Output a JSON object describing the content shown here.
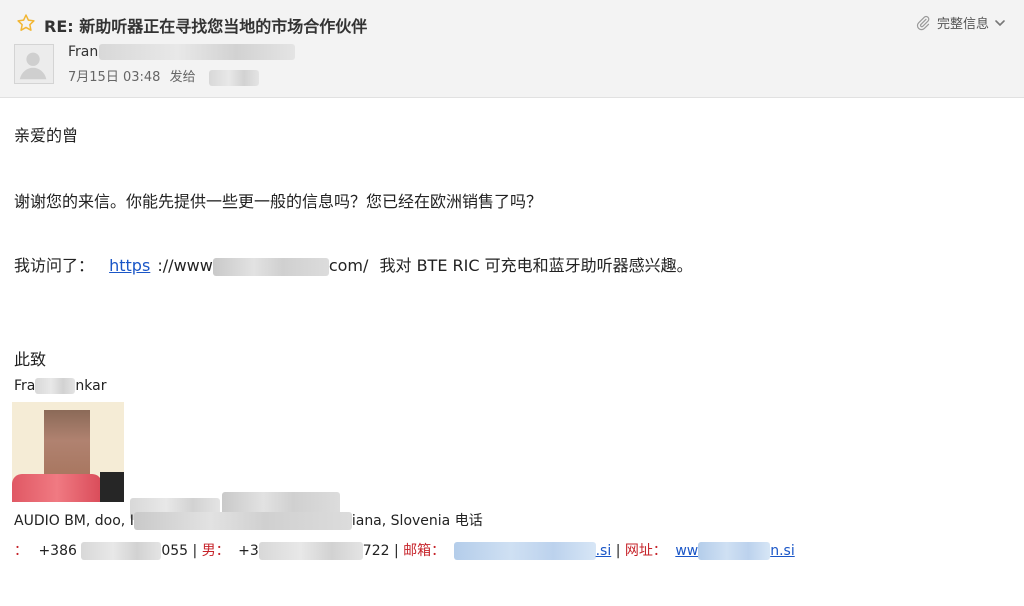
{
  "header": {
    "subject": "RE: 新助听器正在寻找您当地的市场合作伙伴",
    "full_info_label": "完整信息",
    "sender_name": "Fran",
    "date": "7月15日 03:48",
    "sent_to_label": "发给"
  },
  "body": {
    "greeting": "亲爱的曾",
    "line1": "谢谢您的来信。你能先提供一些更一般的信息吗？您已经在欧洲销售了吗？",
    "visit_prefix": "我访问了：",
    "visit_link_scheme": "https",
    "visit_url_prefix": "://www",
    "visit_url_suffix": "com/",
    "visit_suffix": "我对 BTE RIC 可充电和蓝牙助听器感兴趣。",
    "closing": "此致"
  },
  "signature": {
    "name_prefix": "Fra",
    "name_suffix": "nkar",
    "address_prefix": "AUDIO BM, doo, I",
    "address_suffix": "iana, Slovenia 电话",
    "colon_lead": "：",
    "phone1_prefix": "+386",
    "phone1_suffix": "055 |",
    "label_male": "男：",
    "phone2_prefix": "+3",
    "phone2_suffix": "722 |",
    "label_email": "邮箱：",
    "email_suffix": ".si",
    "separator": "|",
    "label_website": "网址：",
    "web_prefix": "ww",
    "web_suffix": "n.si"
  },
  "colors": {
    "accent_red": "#c6232a",
    "link_blue": "#1a56c7",
    "header_bg": "#f3f3f3",
    "star_yellow": "#f2b632"
  },
  "icons": {
    "star": "star-icon",
    "attachment": "paperclip-icon",
    "chevron": "chevron-down-icon",
    "avatar": "default-avatar-icon"
  }
}
